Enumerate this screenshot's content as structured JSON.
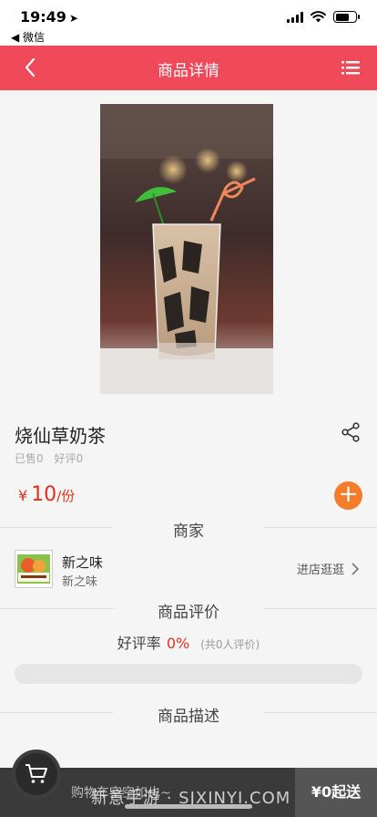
{
  "status_bar": {
    "time": "19:49",
    "back_app": "◀ 微信"
  },
  "nav": {
    "title": "商品详情"
  },
  "product": {
    "name": "烧仙草奶茶",
    "sold": "已售0",
    "good_reviews": "好评0",
    "price_symbol": "¥",
    "price": "10",
    "unit": "/份",
    "add_label": "+"
  },
  "merchant_section": {
    "title": "商家"
  },
  "merchant": {
    "name": "新之味",
    "subtitle": "新之味",
    "visit_label": "进店逛逛"
  },
  "reviews_section": {
    "title": "商品评价",
    "rate_label": "好评率",
    "rate_value": "0%",
    "rate_fraction": 0,
    "count_text": "(共0人评价)"
  },
  "description_section": {
    "title": "商品描述"
  },
  "bottom_bar": {
    "shipping_note": "购物车空空如也~",
    "min_order": "¥0起送",
    "watermark": "新意手游 · SJXINYI.COM"
  },
  "colors": {
    "brand_red": "#f04a5a",
    "price_red": "#e0301e",
    "add_orange": "#f57c2a"
  }
}
